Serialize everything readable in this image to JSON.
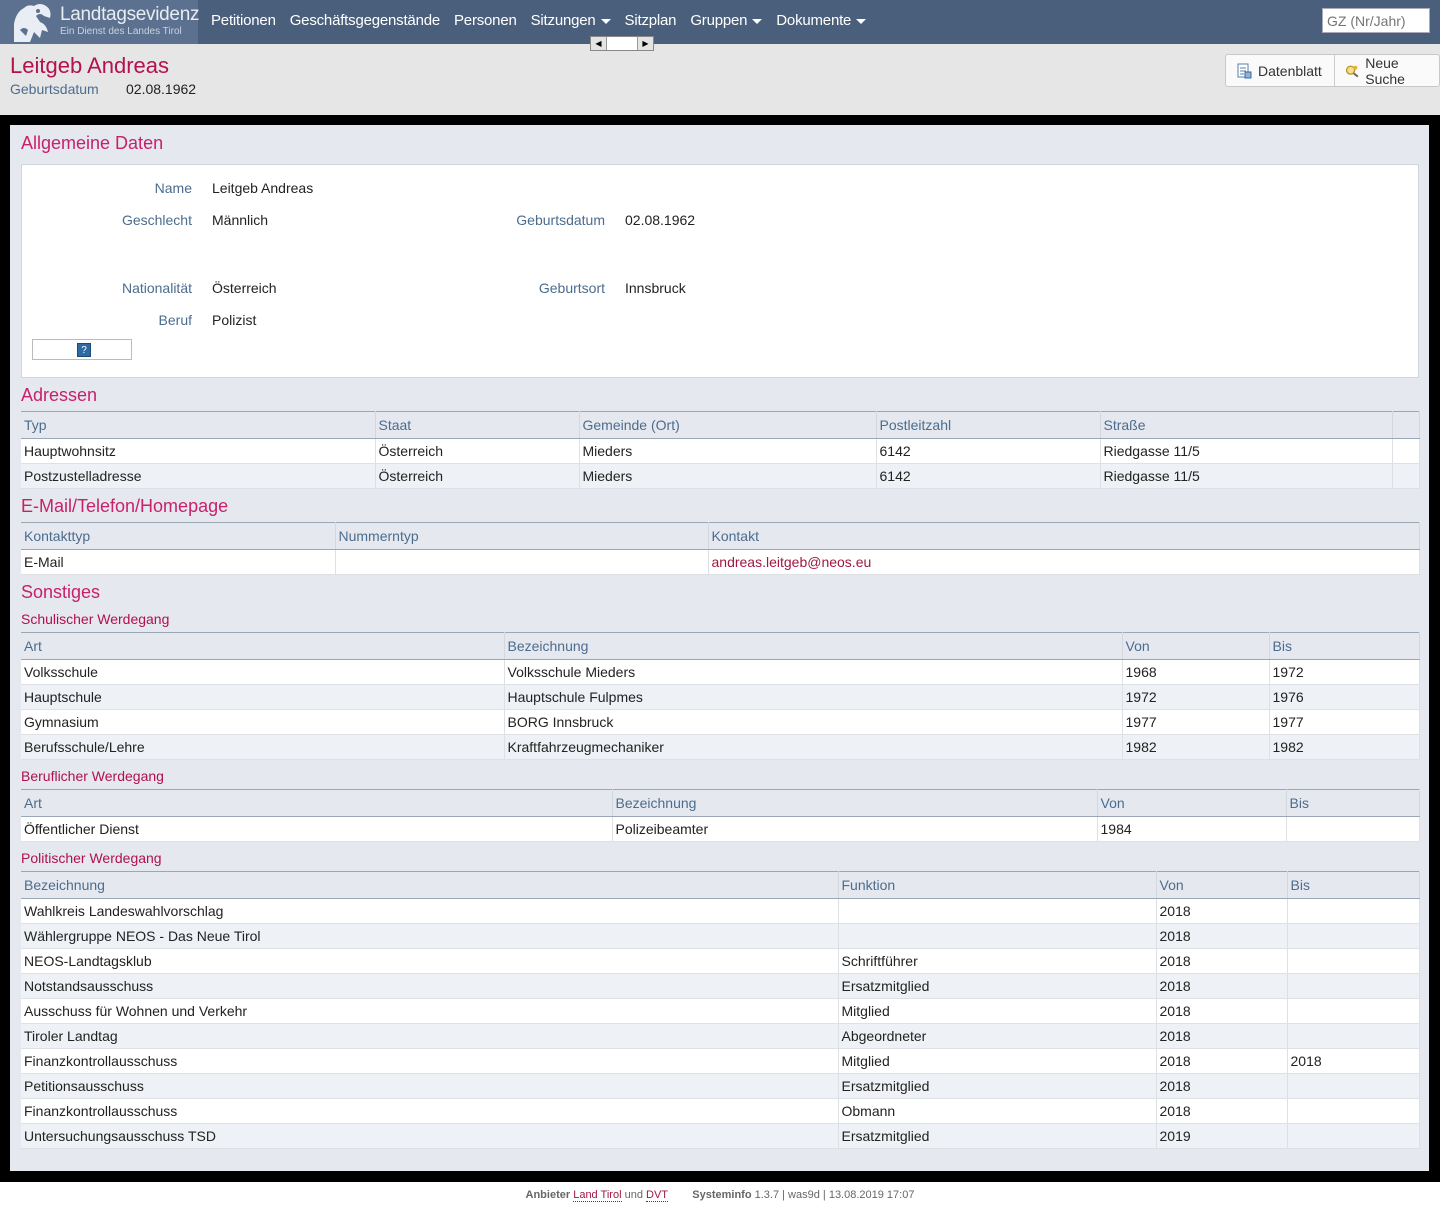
{
  "app": {
    "title": "Landtagsevidenz",
    "subtitle": "Ein Dienst des Landes Tirol"
  },
  "nav": {
    "items": [
      {
        "label": "Petitionen",
        "dropdown": false
      },
      {
        "label": "Geschäftsgegenstände",
        "dropdown": false
      },
      {
        "label": "Personen",
        "dropdown": false
      },
      {
        "label": "Sitzungen",
        "dropdown": true
      },
      {
        "label": "Sitzplan",
        "dropdown": false
      },
      {
        "label": "Gruppen",
        "dropdown": true
      },
      {
        "label": "Dokumente",
        "dropdown": true
      }
    ]
  },
  "search": {
    "placeholder": "GZ (Nr/Jahr)"
  },
  "header": {
    "name": "Leitgeb Andreas",
    "birth_label": "Geburtsdatum",
    "birth_value": "02.08.1962"
  },
  "actions": {
    "datenblatt": "Datenblatt",
    "neue_suche": "Neue Suche"
  },
  "general": {
    "title": "Allgemeine Daten",
    "name_label": "Name",
    "name_value": "Leitgeb Andreas",
    "gender_label": "Geschlecht",
    "gender_value": "Männlich",
    "birth_label": "Geburtsdatum",
    "birth_value": "02.08.1962",
    "nationality_label": "Nationalität",
    "nationality_value": "Österreich",
    "birthplace_label": "Geburtsort",
    "birthplace_value": "Innsbruck",
    "job_label": "Beruf",
    "job_value": "Polizist",
    "help_icon": "?"
  },
  "addresses": {
    "title": "Adressen",
    "columns": [
      "Typ",
      "Staat",
      "Gemeinde (Ort)",
      "Postleitzahl",
      "Straße",
      ""
    ],
    "rows": [
      [
        "Hauptwohnsitz",
        "Österreich",
        "Mieders",
        "6142",
        "Riedgasse 11/5",
        ""
      ],
      [
        "Postzustelladresse",
        "Österreich",
        "Mieders",
        "6142",
        "Riedgasse 11/5",
        ""
      ]
    ]
  },
  "contact": {
    "title": "E-Mail/Telefon/Homepage",
    "columns": [
      "Kontakttyp",
      "Nummerntyp",
      "Kontakt"
    ],
    "rows": [
      [
        "E-Mail",
        "",
        "andreas.leitgeb@neos.eu"
      ]
    ]
  },
  "misc": {
    "title": "Sonstiges"
  },
  "school": {
    "title": "Schulischer Werdegang",
    "columns": [
      "Art",
      "Bezeichnung",
      "Von",
      "Bis"
    ],
    "rows": [
      [
        "Volksschule",
        "Volksschule Mieders",
        "1968",
        "1972"
      ],
      [
        "Hauptschule",
        "Hauptschule Fulpmes",
        "1972",
        "1976"
      ],
      [
        "Gymnasium",
        "BORG Innsbruck",
        "1977",
        "1977"
      ],
      [
        "Berufsschule/Lehre",
        "Kraftfahrzeugmechaniker",
        "1982",
        "1982"
      ]
    ]
  },
  "career": {
    "title": "Beruflicher Werdegang",
    "columns": [
      "Art",
      "Bezeichnung",
      "Von",
      "Bis"
    ],
    "rows": [
      [
        "Öffentlicher Dienst",
        "Polizeibeamter",
        "1984",
        ""
      ]
    ]
  },
  "political": {
    "title": "Politischer Werdegang",
    "columns": [
      "Bezeichnung",
      "Funktion",
      "Von",
      "Bis"
    ],
    "rows": [
      [
        "Wahlkreis Landeswahlvorschlag",
        "",
        "2018",
        ""
      ],
      [
        "Wählergruppe NEOS - Das Neue Tirol",
        "",
        "2018",
        ""
      ],
      [
        "NEOS-Landtagsklub",
        "Schriftführer",
        "2018",
        ""
      ],
      [
        "Notstandsausschuss",
        "Ersatzmitglied",
        "2018",
        ""
      ],
      [
        "Ausschuss für Wohnen und Verkehr",
        "Mitglied",
        "2018",
        ""
      ],
      [
        "Tiroler Landtag",
        "Abgeordneter",
        "2018",
        ""
      ],
      [
        "Finanzkontrollausschuss",
        "Mitglied",
        "2018",
        "2018"
      ],
      [
        "Petitionsausschuss",
        "Ersatzmitglied",
        "2018",
        ""
      ],
      [
        "Finanzkontrollausschuss",
        "Obmann",
        "2018",
        ""
      ],
      [
        "Untersuchungsausschuss TSD",
        "Ersatzmitglied",
        "2019",
        ""
      ]
    ]
  },
  "footer": {
    "provider_label": "Anbieter",
    "provider_1": "Land Tirol",
    "and": "und",
    "provider_2": "DVT",
    "sysinfo_label": "Systeminfo",
    "sysinfo_value": "1.3.7 | was9d | 13.08.2019 17:07"
  },
  "colors": {
    "topbar": "#4a5f7c",
    "accent": "#c8206a",
    "label": "#4c6c8e"
  }
}
